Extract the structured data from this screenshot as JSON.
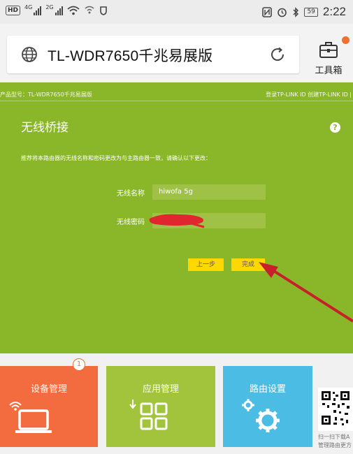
{
  "status_bar": {
    "hd_label": "HD",
    "net1": "4G",
    "net2": "2G",
    "battery": "59",
    "time": "2:22"
  },
  "address_bar": {
    "url_text": "TL-WDR7650千兆易展版",
    "toolbox_label": "工具箱"
  },
  "router_panel": {
    "header_left": "产品型号：TL-WDR7650千兆易展版",
    "header_right": "登录TP-LINK ID  创建TP-LINK ID  |",
    "title": "无线桥接",
    "help": "?",
    "instruction": "推荐将本路由器的无线名称和密码更改为与主路由器一致，请确认以下更改：",
    "ssid_label": "无线名称",
    "ssid_value": "hiwofa 5g",
    "password_label": "无线密码",
    "password_value": "",
    "prev_button": "上一步",
    "finish_button": "完成"
  },
  "tiles": [
    {
      "label": "设备管理",
      "color": "#f36c3f",
      "badge": "1"
    },
    {
      "label": "应用管理",
      "color": "#a2c43c"
    },
    {
      "label": "路由设置",
      "color": "#4bbde5"
    }
  ],
  "qr_caption_1": "扫一扫下载A",
  "qr_caption_2": "管理路由更方",
  "colors": {
    "panel_green": "#8ab629",
    "tile_orange": "#f36c3f",
    "tile_green": "#a2c43c",
    "tile_blue": "#4bbde5",
    "button_yellow": "#ffd800",
    "annotation_red": "#c8202a"
  }
}
